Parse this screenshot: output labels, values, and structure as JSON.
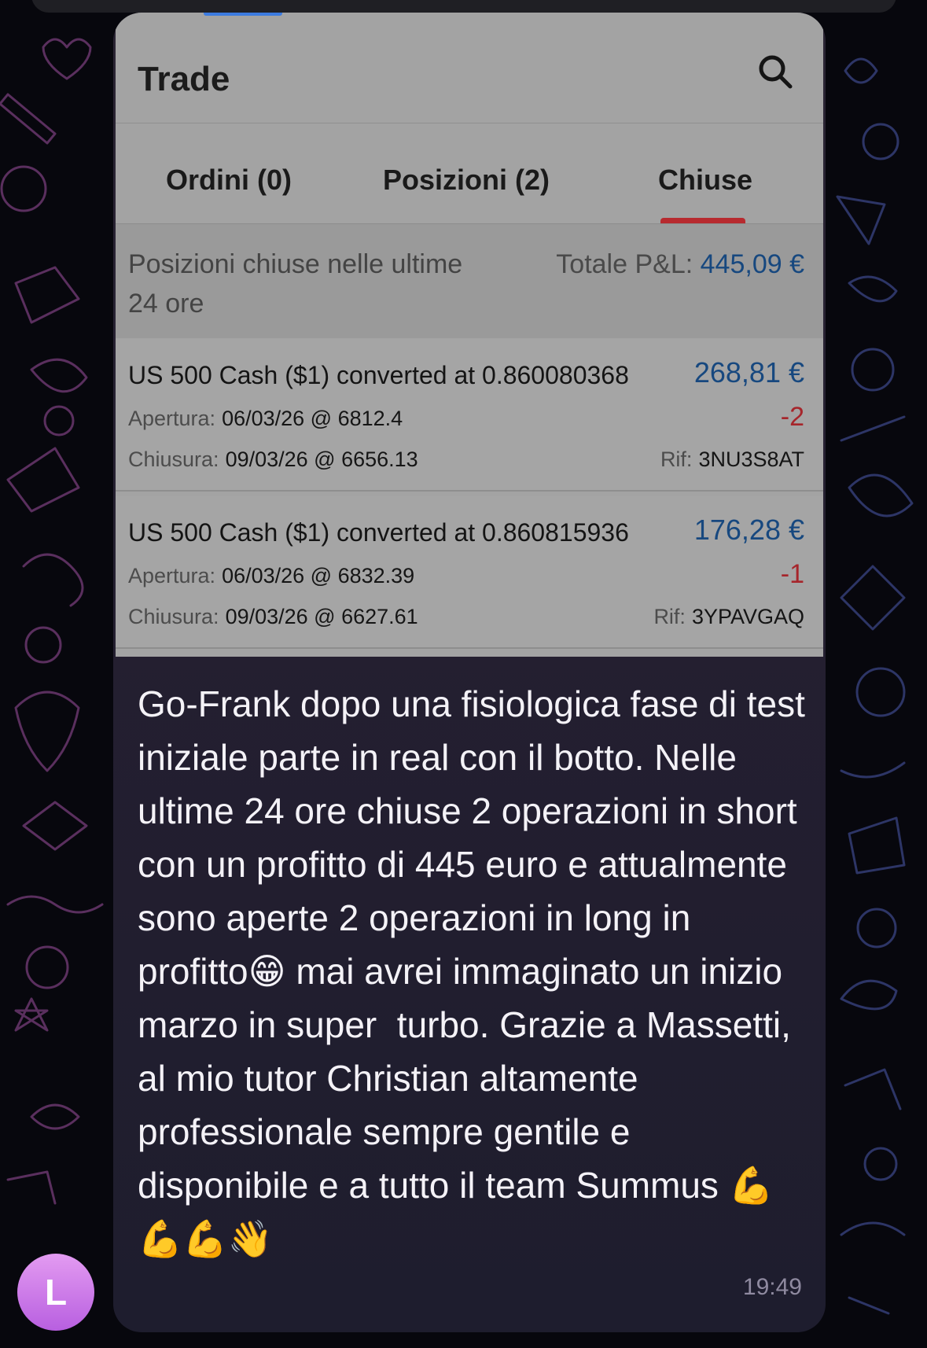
{
  "app": {
    "title": "Trade",
    "search_icon": "search-icon"
  },
  "tabs": [
    {
      "label": "Ordini (0)",
      "active": false
    },
    {
      "label": "Posizioni (2)",
      "active": false
    },
    {
      "label": "Chiuse",
      "active": true
    }
  ],
  "summary": {
    "caption": "Posizioni chiuse nelle ultime 24 ore",
    "total_label": "Totale P&L:",
    "total_value": "445,09 €"
  },
  "positions": [
    {
      "name": "US 500 Cash ($1) converted at 0.860080368",
      "pnl": "268,81 €",
      "open_label": "Apertura:",
      "open_value": "06/03/26 @ 6812.4",
      "close_label": "Chiusura:",
      "close_value": "09/03/26 @ 6656.13",
      "quantity": "-2",
      "ref_label": "Rif:",
      "ref_value": "3NU3S8AT"
    },
    {
      "name": "US 500 Cash ($1) converted at 0.860815936",
      "pnl": "176,28 €",
      "open_label": "Apertura:",
      "open_value": "06/03/26 @ 6832.39",
      "close_label": "Chiusura:",
      "close_value": "09/03/26 @ 6627.61",
      "quantity": "-1",
      "ref_label": "Rif:",
      "ref_value": "3YPAVGAQ"
    }
  ],
  "message": {
    "text": "Go-Frank dopo una fisiologica fase di test  iniziale parte in real con il botto. Nelle ultime 24 ore chiuse 2 operazioni in short con un profitto di 445 euro e attualmente sono aperte 2 operazioni in long in profitto😁 mai avrei immaginato un inizio marzo in super  turbo. Grazie a Massetti, al mio tutor Christian altamente professionale sempre gentile e disponibile e a tutto il team Summus 💪💪💪👋",
    "time": "19:49"
  },
  "sender": {
    "avatar_letter": "L"
  },
  "colors": {
    "profit_blue": "#17487f",
    "quantity_red": "#a6252b",
    "tab_underline": "#b72a2f",
    "avatar_gradient_top": "#e39bf1",
    "avatar_gradient_bottom": "#b85fe0",
    "doodle_purple": "#5a2f5e",
    "doodle_blue": "#2d3566"
  }
}
